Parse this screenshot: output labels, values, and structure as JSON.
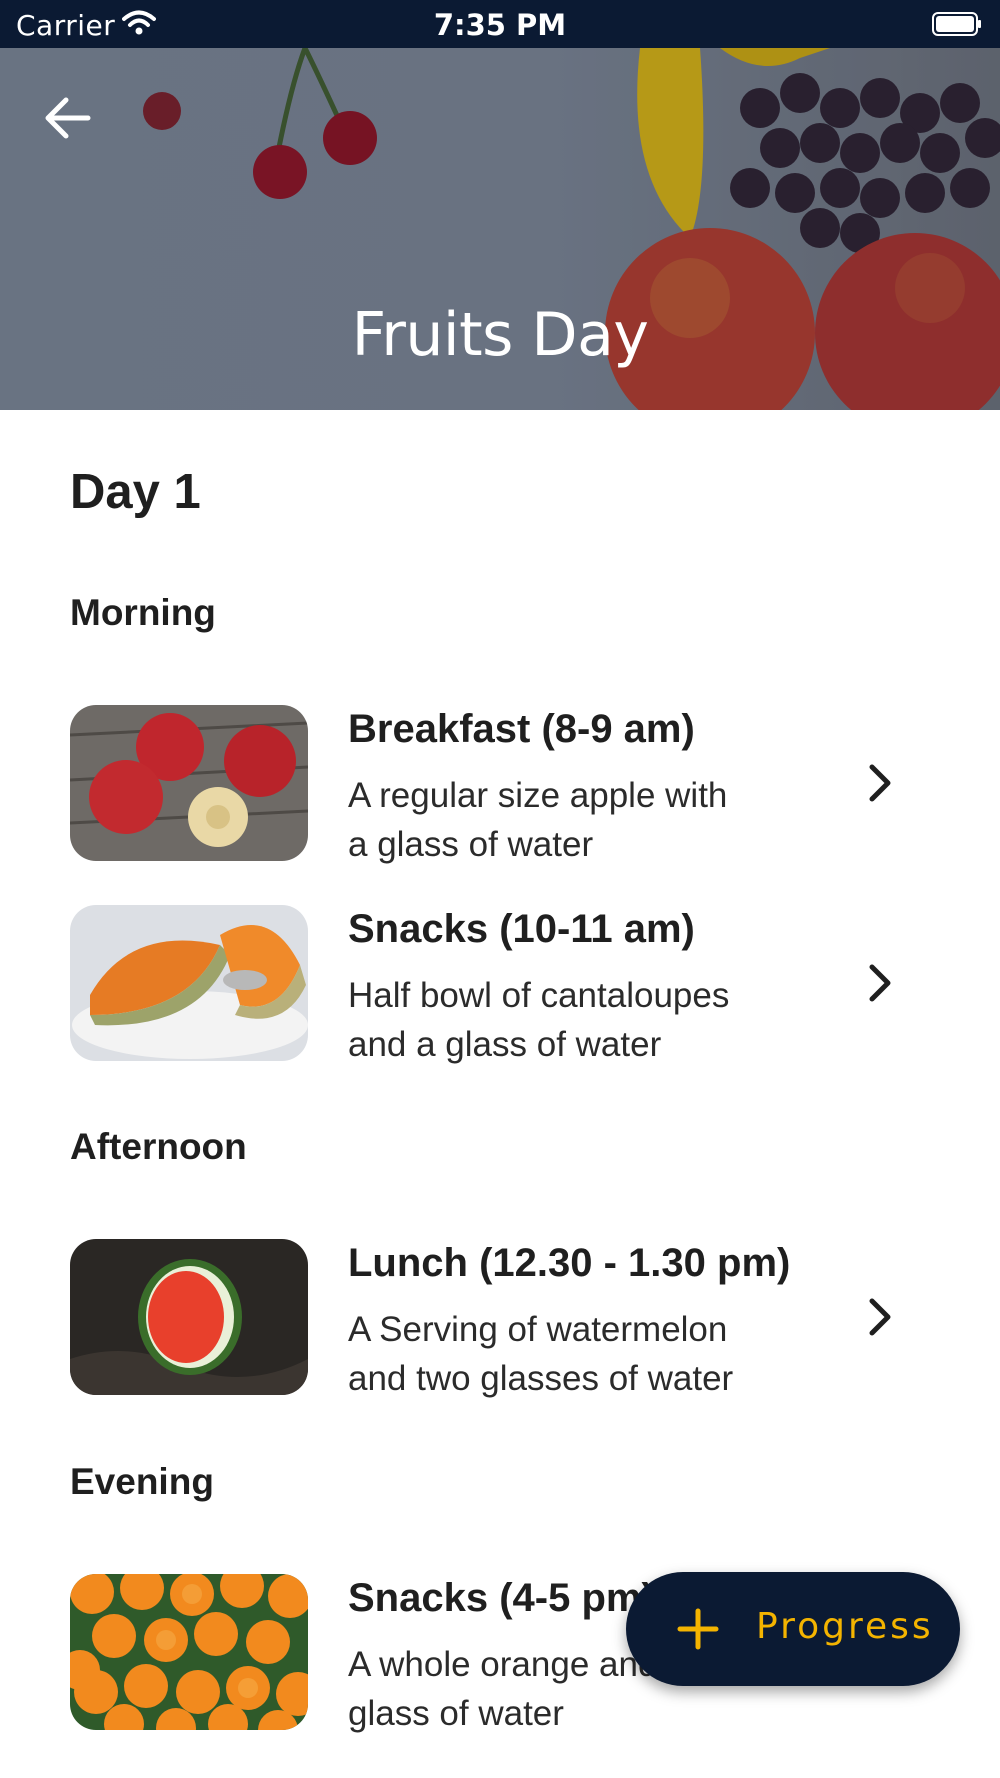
{
  "status_bar": {
    "carrier": "Carrier",
    "time": "7:35 PM"
  },
  "header": {
    "title": "Fruits Day"
  },
  "day_title": "Day 1",
  "sections": [
    {
      "title": "Morning"
    },
    {
      "title": "Afternoon"
    },
    {
      "title": "Evening"
    }
  ],
  "meals": [
    {
      "title": "Breakfast (8-9 am)",
      "line1": "A regular size apple with",
      "line2": "a glass of water",
      "image": "apples"
    },
    {
      "title": "Snacks (10-11 am)",
      "line1": "Half bowl of cantaloupes",
      "line2": "and a glass of water",
      "image": "cantaloupe"
    },
    {
      "title": "Lunch (12.30 - 1.30 pm)",
      "line1": "A Serving of watermelon",
      "line2": "and two glasses of water",
      "image": "watermelon"
    },
    {
      "title": "Snacks (4-5 pm)",
      "line1": "A whole orange and",
      "line2": "glass of water",
      "image": "oranges"
    }
  ],
  "fab": {
    "label": "Progress"
  },
  "colors": {
    "navy": "#0b1a33",
    "accent": "#f4b400"
  }
}
